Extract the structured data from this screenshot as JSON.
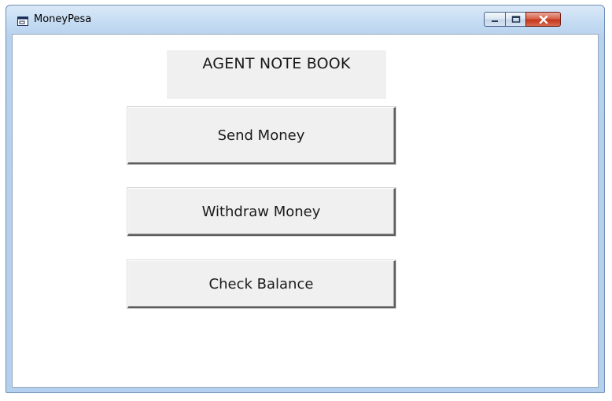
{
  "window": {
    "title": "MoneyPesa",
    "icon": "app-window-icon"
  },
  "caption_buttons": {
    "minimize_icon": "minimize-icon",
    "maximize_icon": "maximize-icon",
    "close_icon": "close-icon",
    "close_color": "#c4361b"
  },
  "main": {
    "heading": "AGENT NOTE BOOK",
    "buttons": {
      "send": "Send Money",
      "withdraw": "Withdraw Money",
      "balance": "Check Balance"
    }
  }
}
